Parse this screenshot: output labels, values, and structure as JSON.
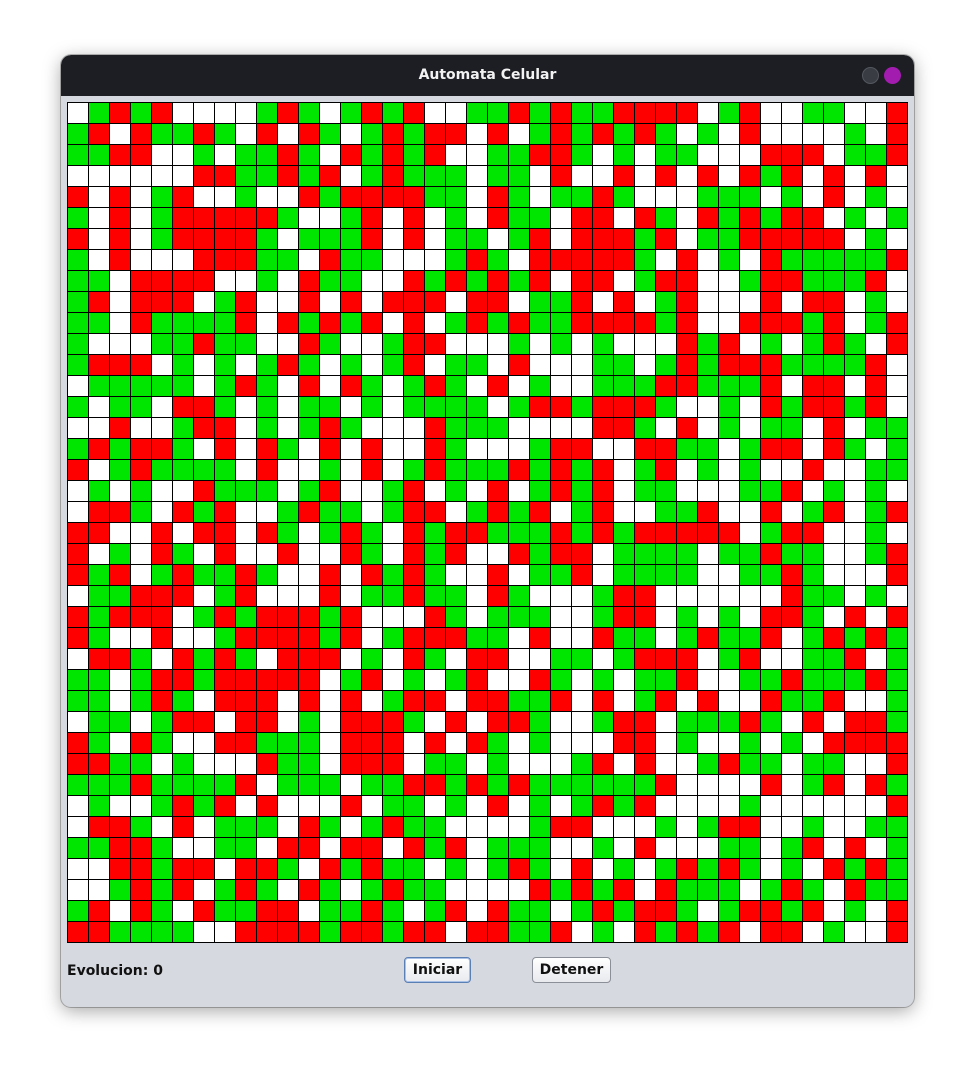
{
  "window": {
    "title": "Automata Celular",
    "accent_close": "#a31cb0"
  },
  "colors": {
    "green": "#00e600",
    "red": "#ff0000",
    "white": "#ffffff"
  },
  "grid": {
    "rows": 40,
    "cols": 40,
    "cells": [
      "wgrgrwwwwgrgwgrgrwwggrgrggrrrrwgrwwggwwr",
      "grwrggrgwrwrgwgrgrrwrwgrgrgrgwgwrwwwwgwr",
      "ggrrwwgwggrgwrgrgrwwggrrgwgwggwwwrrrwggr",
      "wwwwwwrrggrgrwgrgggwggwrwwrwrwrwrgrwrwrw",
      "rwrwgrwwgwwrgrrrrggwrgwggrgwwwgggwgwrwgw",
      "gwrwgrrrrrgwwgrwrwgwrggwrrwrgwrgrgrrwgwg",
      "rwrwgrrrrgwgggrwrwggwgrwrrrgrwggrrrrrwgw",
      "gwrwwwrrrggwrggwwwgrgwrrrrrgwrwgwrgggggr",
      "ggwrrrrwwgwrggwwrgrgrgrwrrwgrrwwgrrgggrw",
      "grwrrrwgrwwrwrwrrrwrrwggrwrwgrwwwrwrrwgw",
      "ggwrggggrwrgrgrwrwgrgrggrrrrgrwwrrrgrwgr",
      "gwwwggrggwwrgwwgrrwwwgwgwgwwwrgrwgwgrgwr",
      "grrrwgwgwgrgwgwgrwggwrwwwggwgrgrrrggggrw",
      "wgggggwgrgwrwrgwgrgwrwgwwgggrrgggrwrrwrw",
      "gwggwrrgwgwggwgwggggwgrrgrrrgwwgwrgrrgrw",
      "wwrwwgrrwgwgrgwwwrgggwwwwrrgwrwgwggwrwgg",
      "grgrrgwrwrgwrwrwwrgwwwgrrwwrrggwgrrwrgwg",
      "rwgrggggwrwwgwrwgrgggrgrgrwgrwgwgwwrwwgg",
      "wgwgwwrgggwgrwwgrwgwrwgrgrwggwwwggrwgwgw",
      "wrrgwrgrwwgrggwgrrwgrgrwgrwwggrwwrwgrwgr",
      "rrwwrwrrwrgwgrgwrgrrgggrgrgrrrrrwgrrwwgw",
      "rwgwrgwrwwrwwrgwrgrwwrgrrwggggwggrggwwgr",
      "rgrwgrggrgwwrwrgrgwwrwggrwggggwwggrgwwwr",
      "wggrrrwgrwwwrwggrggwrgwwwgrrwwwwwwrggwgw",
      "rgrrrwgrgrrrgrwwwrgwgggwwgrrwgwgwrrgwrwr",
      "rgwwrwwgrrrrgrwgrrrggwrwwrggwgrggrwgrgrg",
      "wrrgwrgrgwrrrwgwrgwrrwwggwgrrrwgrwwggrwg",
      "ggwgrrgrrrrrwgrwgwgrwwrgwgwggrwwggrgggrg",
      "ggwgrgwrrrwrwrwgrrwrrggrwrwgrwrwwrggrwwg",
      "wggwgrrwrrwgwrrrgwrwrrgwwgrrwgggrgwrwrrg",
      "rgwrgwwrrgggwrrrwrwrgwgwwwrrwgwwgwgwrrrr",
      "rrggwgwwwrggwrrrwggwgwwwgrwrwwgrggwggwwr",
      "gggrggggrwgggwggrrgrgrggggggrwwwwrwgrwrg",
      "wgwwgrgrwrwwwrwggwgwrwgwgrgrwwwwgwwwwwwr",
      "wrrgwrwgggwrgwgrggwwwwgrrwwwgwgrrwwgwwgg",
      "ggrrgwwggwrrwrrwrgrwgggwwgwrwwwggwgrwrwg",
      "wwrrgrrwrrgwrgrggwgwgrgwrwgwgrgrgwgwrgrg",
      "wwgrgrwgrgwrgwgrggwwwwrgrgrwrgggwgrgwrgg",
      "grwrgwrggrrwggrgwgrwrggwgrgrrgwgrrgrwgwr",
      "rrggggwwrrrrgrrgrrwrrggrwgwrgrgrwrrwgwwr"
    ]
  },
  "status": {
    "label": "Evolucion: 0"
  },
  "controls": {
    "start_label": "Iniciar",
    "stop_label": "Detener"
  }
}
